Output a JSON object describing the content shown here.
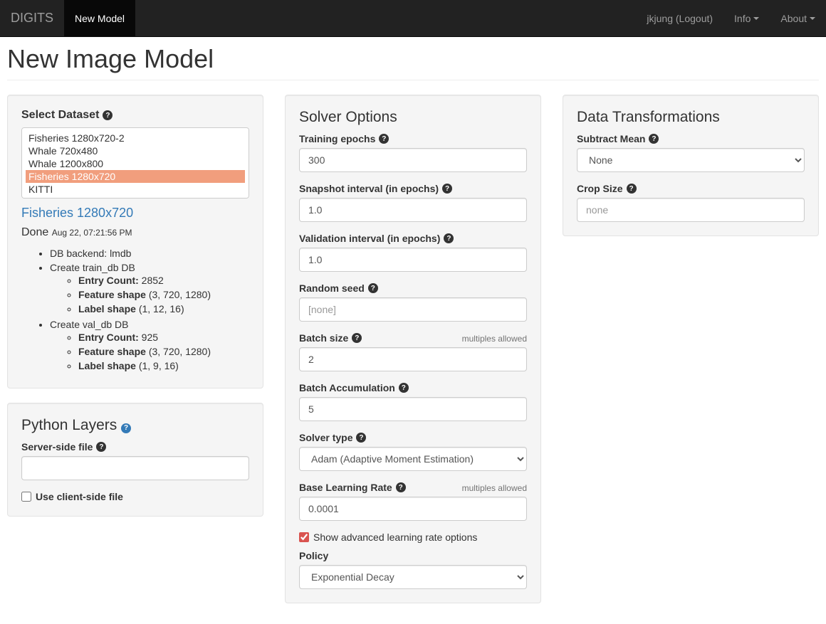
{
  "nav": {
    "brand": "DIGITS",
    "active": "New Model",
    "right": {
      "user": "jkjung (Logout)",
      "info": "Info",
      "about": "About"
    }
  },
  "page_title": "New Image Model",
  "dataset_panel": {
    "title": "Select Dataset",
    "options": [
      "Fisheries 1280x720-2",
      "Whale 720x480",
      "Whale 1200x800",
      "Fisheries 1280x720",
      "KITTI"
    ],
    "selected_index": 3,
    "selected_name": "Fisheries 1280x720",
    "done_label": "Done",
    "done_ts": "Aug 22, 07:21:56 PM",
    "details": {
      "db_backend_label": "DB backend:",
      "db_backend_value": "lmdb",
      "train_db_label": "Create train_db DB",
      "train": {
        "entry_count_label": "Entry Count:",
        "entry_count": "2852",
        "feature_shape_label": "Feature shape",
        "feature_shape": "(3, 720, 1280)",
        "label_shape_label": "Label shape",
        "label_shape": "(1, 12, 16)"
      },
      "val_db_label": "Create val_db DB",
      "val": {
        "entry_count_label": "Entry Count:",
        "entry_count": "925",
        "feature_shape_label": "Feature shape",
        "feature_shape": "(3, 720, 1280)",
        "label_shape_label": "Label shape",
        "label_shape": "(1, 9, 16)"
      }
    }
  },
  "python_layers": {
    "title": "Python Layers",
    "server_side_label": "Server-side file",
    "client_side_label": "Use client-side file"
  },
  "solver": {
    "title": "Solver Options",
    "training_epochs_label": "Training epochs",
    "training_epochs": "300",
    "snapshot_interval_label": "Snapshot interval (in epochs)",
    "snapshot_interval": "1.0",
    "validation_interval_label": "Validation interval (in epochs)",
    "validation_interval": "1.0",
    "random_seed_label": "Random seed",
    "random_seed_placeholder": "[none]",
    "batch_size_label": "Batch size",
    "multiples_hint": "multiples allowed",
    "batch_size": "2",
    "batch_accum_label": "Batch Accumulation",
    "batch_accum": "5",
    "solver_type_label": "Solver type",
    "solver_type": "Adam (Adaptive Moment Estimation)",
    "base_lr_label": "Base Learning Rate",
    "base_lr": "0.0001",
    "show_advanced_label": "Show advanced learning rate options",
    "policy_label": "Policy",
    "policy": "Exponential Decay"
  },
  "transforms": {
    "title": "Data Transformations",
    "subtract_mean_label": "Subtract Mean",
    "subtract_mean": "None",
    "crop_size_label": "Crop Size",
    "crop_size_placeholder": "none"
  }
}
